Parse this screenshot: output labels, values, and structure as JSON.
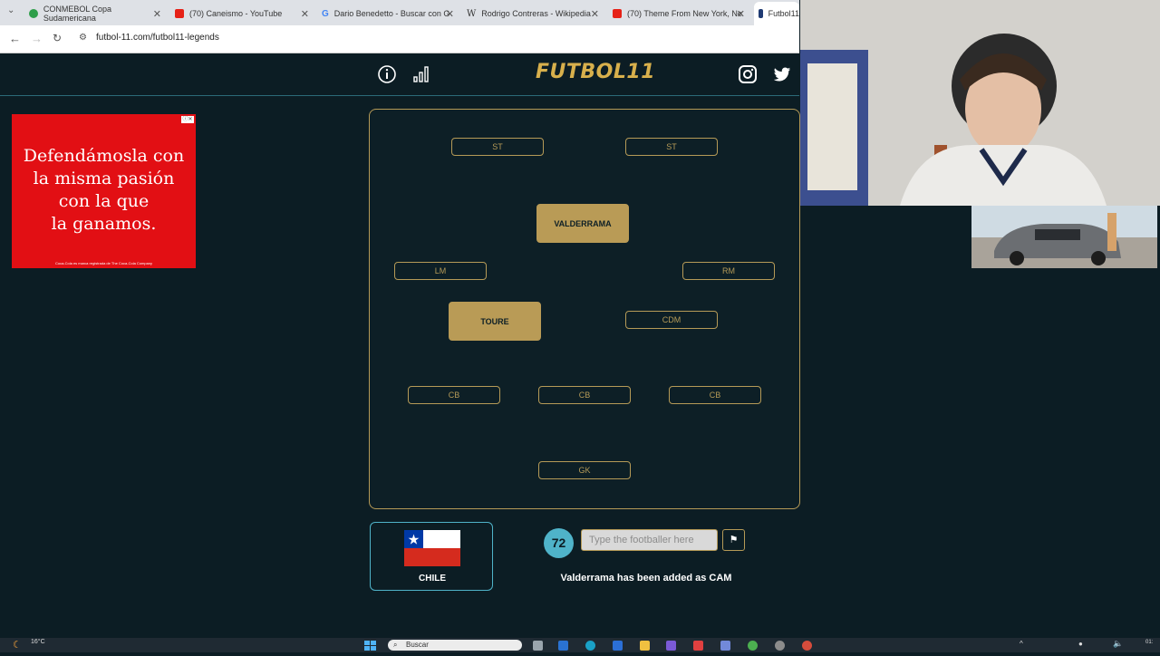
{
  "browser": {
    "tabs": [
      {
        "label": "CONMEBOL Copa Sudamericana",
        "color": "#2e9e4a"
      },
      {
        "label": "(70) Caneismo - YouTube",
        "color": "#e62117"
      },
      {
        "label": "Dario Benedetto - Buscar con G",
        "color": "#4285f4"
      },
      {
        "label": "Rodrigo Contreras - Wikipedia",
        "color": "#444444"
      },
      {
        "label": "(70) Theme From New York, Ne",
        "color": "#e62117"
      },
      {
        "label": "Futbol11",
        "color": "#1f3b73"
      }
    ],
    "url": "futbol-11.com/futbol11-legends"
  },
  "site": {
    "logo": "FUTBOL11",
    "accent": "#d8b04c",
    "teal": "#4fb3c9"
  },
  "ad": {
    "text_lines": [
      "Defendámosla con",
      "la misma pasión",
      "con la que",
      "la ganamos."
    ],
    "fine_print": "Coca-Cola es marca registrada de The Coca-Cola Company"
  },
  "pitch": {
    "st_left": "ST",
    "st_right": "ST",
    "cam": "VALDERRAMA",
    "lm": "LM",
    "rm": "RM",
    "cm": "TOURE",
    "cdm": "CDM",
    "cb_left": "CB",
    "cb_center": "CB",
    "cb_right": "CB",
    "gk": "GK"
  },
  "clue": {
    "country": "CHILE"
  },
  "guess": {
    "score": "72",
    "placeholder": "Type the footballer here",
    "status": "Valderrama has been added as CAM"
  },
  "taskbar": {
    "temperature": "16°C",
    "weather": "Despejado",
    "search": "Buscar",
    "time": "01:"
  }
}
